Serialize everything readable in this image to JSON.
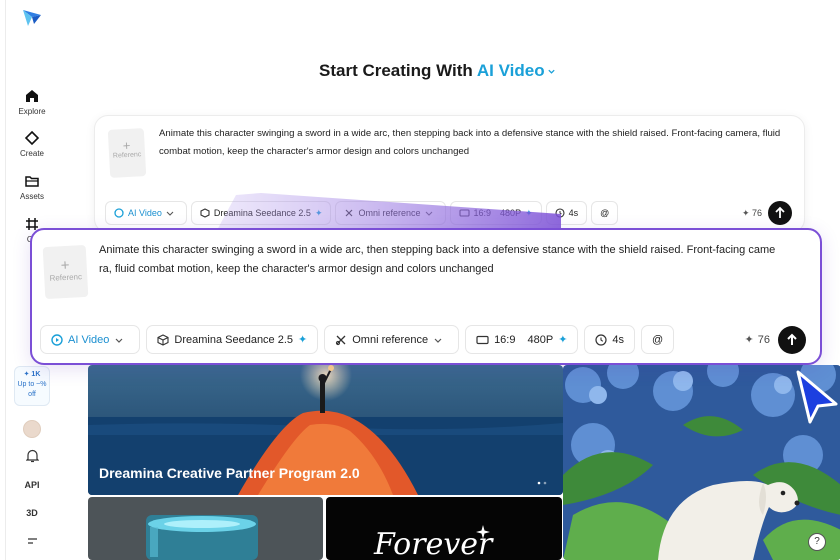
{
  "sidebar": {
    "items": [
      {
        "label": "Explore",
        "icon": "home-icon"
      },
      {
        "label": "Create",
        "icon": "create-icon"
      },
      {
        "label": "Assets",
        "icon": "folder-icon"
      },
      {
        "label": "Ca",
        "icon": "canvas-icon"
      }
    ],
    "promo": {
      "line1": "✦ 1K",
      "line2": "Up to ~%",
      "line3": "off"
    },
    "bottom": [
      "API",
      "3D"
    ]
  },
  "header": {
    "prefix": "Start Creating With ",
    "mode": "AI Video"
  },
  "prompt": {
    "reference_label": "Referenc",
    "text": "Animate this character swinging a sword in a wide arc, then stepping back into a defensive stance with the shield raised. Front-facing camera, fluid combat motion, keep the character's armor design and colors unchanged",
    "text_line1": "Animate this character swinging a sword in a wide arc, then stepping back into a defensive stance with the shield raised. Front-facing came",
    "text_line2": "ra, fluid combat motion, keep the character's armor design and colors unchanged",
    "toolbar": {
      "mode": "AI Video",
      "model": "Dreamina Seedance 2.5",
      "reference": "Omni reference",
      "ratio": "16:9",
      "resolution": "480P",
      "duration": "4s",
      "mention": "@"
    },
    "credits": "76"
  },
  "gallery": {
    "banner_title": "Dreamina Creative Partner Program 2.0",
    "tile_text": "Forever"
  },
  "help": "?",
  "colors": {
    "accent": "#1aa0d8",
    "highlight": "#7b4fd6",
    "cursor": "#1c3fe0"
  }
}
